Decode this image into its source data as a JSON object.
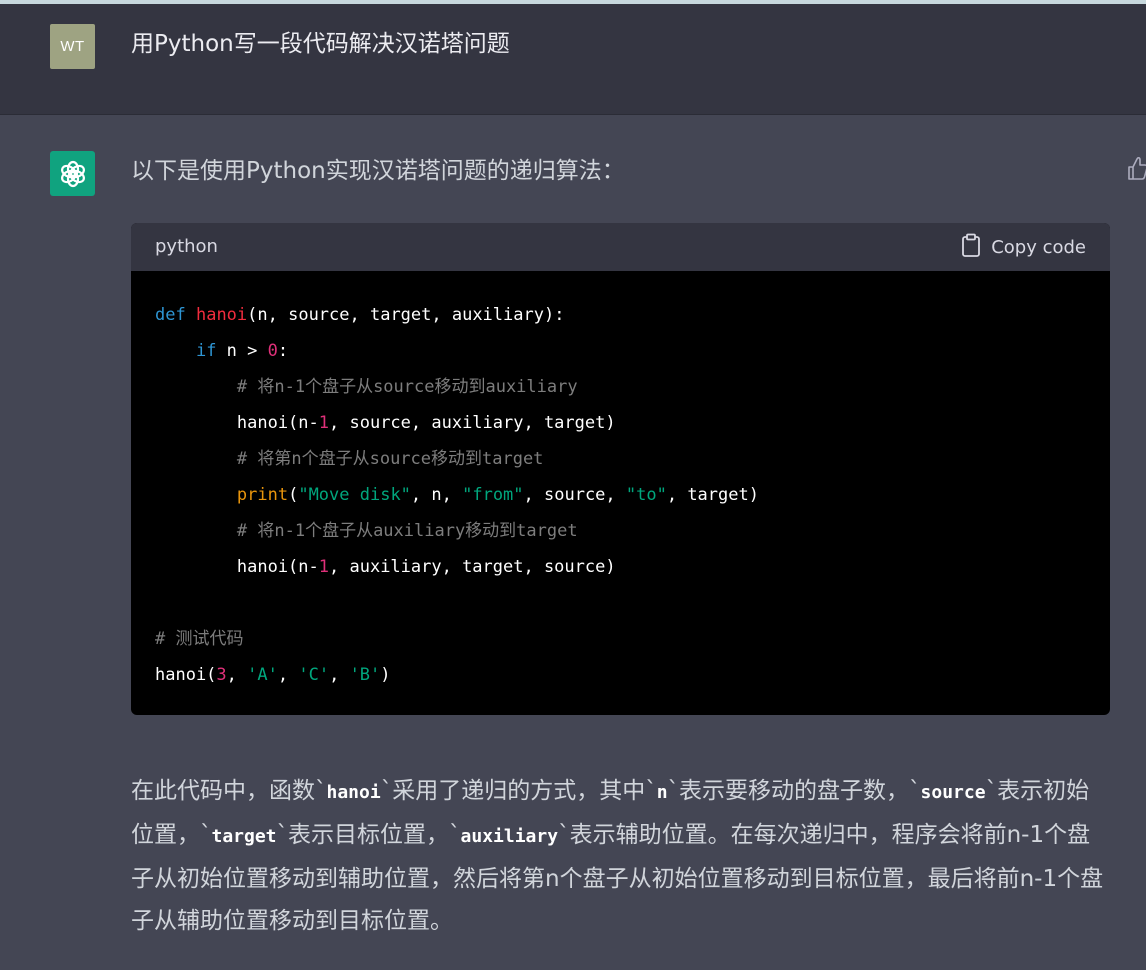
{
  "user_message": {
    "avatar_initials": "WT",
    "text": "用Python写一段代码解决汉诺塔问题"
  },
  "assistant_message": {
    "intro": "以下是使用Python实现汉诺塔问题的递归算法：",
    "code_block": {
      "language": "python",
      "copy_label": "Copy code",
      "lines": [
        [
          {
            "t": "def",
            "c": "kw"
          },
          {
            "t": " "
          },
          {
            "t": "hanoi",
            "c": "fn"
          },
          {
            "t": "(n, source, target, auxiliary):"
          }
        ],
        [
          {
            "t": "    "
          },
          {
            "t": "if",
            "c": "kw"
          },
          {
            "t": " n > "
          },
          {
            "t": "0",
            "c": "num"
          },
          {
            "t": ":"
          }
        ],
        [
          {
            "t": "        "
          },
          {
            "t": "# 将n-1个盘子从source移动到auxiliary",
            "c": "cm"
          }
        ],
        [
          {
            "t": "        hanoi(n-"
          },
          {
            "t": "1",
            "c": "num"
          },
          {
            "t": ", source, auxiliary, target)"
          }
        ],
        [
          {
            "t": "        "
          },
          {
            "t": "# 将第n个盘子从source移动到target",
            "c": "cm"
          }
        ],
        [
          {
            "t": "        "
          },
          {
            "t": "print",
            "c": "bi"
          },
          {
            "t": "("
          },
          {
            "t": "\"Move disk\"",
            "c": "str"
          },
          {
            "t": ", n, "
          },
          {
            "t": "\"from\"",
            "c": "str"
          },
          {
            "t": ", source, "
          },
          {
            "t": "\"to\"",
            "c": "str"
          },
          {
            "t": ", target)"
          }
        ],
        [
          {
            "t": "        "
          },
          {
            "t": "# 将n-1个盘子从auxiliary移动到target",
            "c": "cm"
          }
        ],
        [
          {
            "t": "        hanoi(n-"
          },
          {
            "t": "1",
            "c": "num"
          },
          {
            "t": ", auxiliary, target, source)"
          }
        ],
        [
          {
            "t": ""
          }
        ],
        [
          {
            "t": "# 测试代码",
            "c": "cm"
          }
        ],
        [
          {
            "t": "hanoi("
          },
          {
            "t": "3",
            "c": "num"
          },
          {
            "t": ", "
          },
          {
            "t": "'A'",
            "c": "str"
          },
          {
            "t": ", "
          },
          {
            "t": "'C'",
            "c": "str"
          },
          {
            "t": ", "
          },
          {
            "t": "'B'",
            "c": "str"
          },
          {
            "t": ")"
          }
        ]
      ]
    },
    "explanation": [
      {
        "t": "在此代码中，函数`"
      },
      {
        "t": "hanoi",
        "code": true
      },
      {
        "t": "`采用了递归的方式，其中`"
      },
      {
        "t": "n",
        "code": true
      },
      {
        "t": "`表示要移动的盘子数，`"
      },
      {
        "t": "source",
        "code": true
      },
      {
        "t": "`表示初始位置，`"
      },
      {
        "t": "target",
        "code": true
      },
      {
        "t": "`表示目标位置，`"
      },
      {
        "t": "auxiliary",
        "code": true
      },
      {
        "t": "`表示辅助位置。在每次递归中，程序会将前n-1个盘子从初始位置移动到辅助位置，然后将第n个盘子从初始位置移动到目标位置，最后将前n-1个盘子从辅助位置移动到目标位置。"
      }
    ]
  },
  "icons": {
    "bot_avatar": "openai-logo-icon",
    "copy": "clipboard-icon",
    "feedback": "thumbs-up-icon"
  },
  "colors": {
    "user_bg": "#343541",
    "assistant_bg": "#444654",
    "bot_avatar": "#10a37f",
    "user_avatar": "#9ea382",
    "code_keyword": "#2e95d3",
    "code_function": "#f22c3d",
    "code_number": "#df3079",
    "code_string": "#00a67d",
    "code_comment": "#7d7d7d",
    "code_builtin": "#e9950c"
  }
}
